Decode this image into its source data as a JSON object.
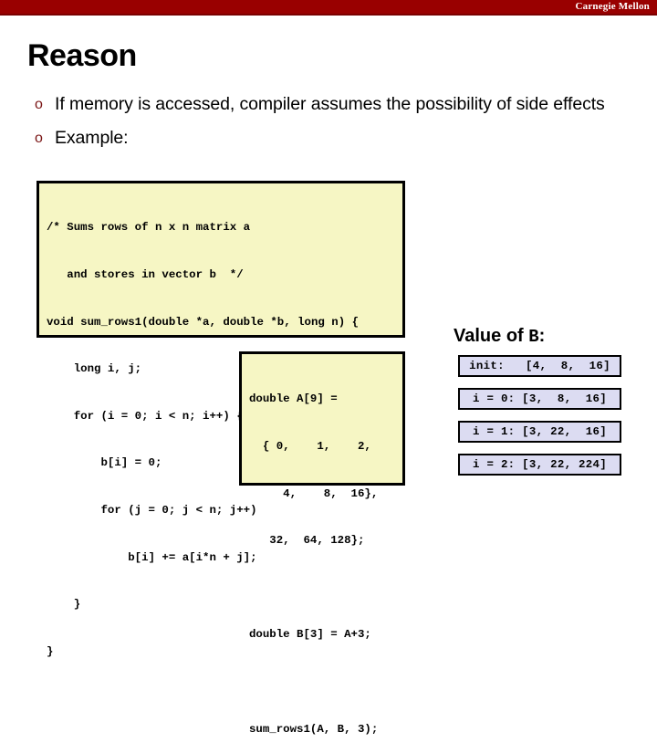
{
  "banner": {
    "institution": "Carnegie Mellon"
  },
  "slide": {
    "title": "Reason"
  },
  "bullets": {
    "marker": "o",
    "items": [
      "If memory is accessed, compiler assumes the possibility of side effects",
      "Example:"
    ]
  },
  "code_main": {
    "lines": [
      "/* Sums rows of n x n matrix a",
      "   and stores in vector b  */",
      "void sum_rows1(double *a, double *b, long n) {",
      "    long i, j;",
      "    for (i = 0; i < n; i++) {",
      "        b[i] = 0;",
      "        for (j = 0; j < n; j++)",
      "            b[i] += a[i*n + j];",
      "    }",
      "}"
    ]
  },
  "code_driver": {
    "lines": [
      "double A[9] =",
      "  { 0,    1,    2,",
      "     4,    8,  16},",
      "   32,  64, 128};",
      "",
      "double B[3] = A+3;",
      "",
      "sum_rows1(A, B, 3);"
    ]
  },
  "value_panel": {
    "heading_prefix": "Value of ",
    "heading_var": "B",
    "heading_suffix": ":",
    "badges": [
      "init:   [4,  8,  16]",
      "i = 0: [3,  8,  16]",
      "i = 1: [3, 22,  16]",
      "i = 2: [3, 22, 224]"
    ]
  },
  "colors": {
    "banner_red": "#990000",
    "bullet_marker": "#7a1515",
    "code_background": "#f6f6c4",
    "badge_background": "#dcdcf2",
    "border": "#000000"
  }
}
